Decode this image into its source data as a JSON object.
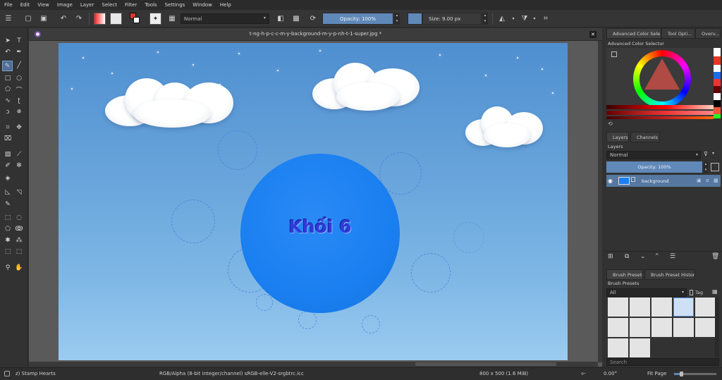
{
  "menu": [
    "File",
    "Edit",
    "View",
    "Image",
    "Layer",
    "Select",
    "Filter",
    "Tools",
    "Settings",
    "Window",
    "Help"
  ],
  "toolbar": {
    "blend_mode": "Normal",
    "opacity": "Opacity: 100%",
    "size": "Size: 9.00 px"
  },
  "document": {
    "tab_title": "t-ng-h-p-c-c-m-y-background-m-y-p-nh-t-1-super.jpg *",
    "canvas_text": "Khối 6"
  },
  "dock": {
    "top_tabs": [
      "Advanced Color Sele...",
      "Tool Opti...",
      "Overv..."
    ],
    "color_panel_title": "Advanced Color Selector",
    "layer_tabs": [
      "Layers",
      "Channels"
    ],
    "layers_title": "Layers",
    "layers_blend": "Normal",
    "layers_opacity": "Opacity:  100%",
    "layer_name": "background",
    "brush_tabs": [
      "Brush Presets",
      "Brush Preset History"
    ],
    "brush_title": "Brush Presets",
    "brush_filter": "All",
    "brush_tag": "Tag",
    "search_placeholder": "Search"
  },
  "status": {
    "brush": "z) Stamp Hearts",
    "colorspace": "RGB/Alpha (8-bit integer/channel)  sRGB-elle-V2-srgbtrc.icc",
    "dimensions": "800 x 500 (1.6 MiB)",
    "rotation": "0.00°",
    "zoom": "Fit Page"
  },
  "colors": {
    "accent": "#6088b8",
    "foreground_swatch": "#d83a2a",
    "canvas_sky": "#6aa6dc",
    "circle": "#1a7ff0",
    "layer_selected": "#5577a0"
  }
}
